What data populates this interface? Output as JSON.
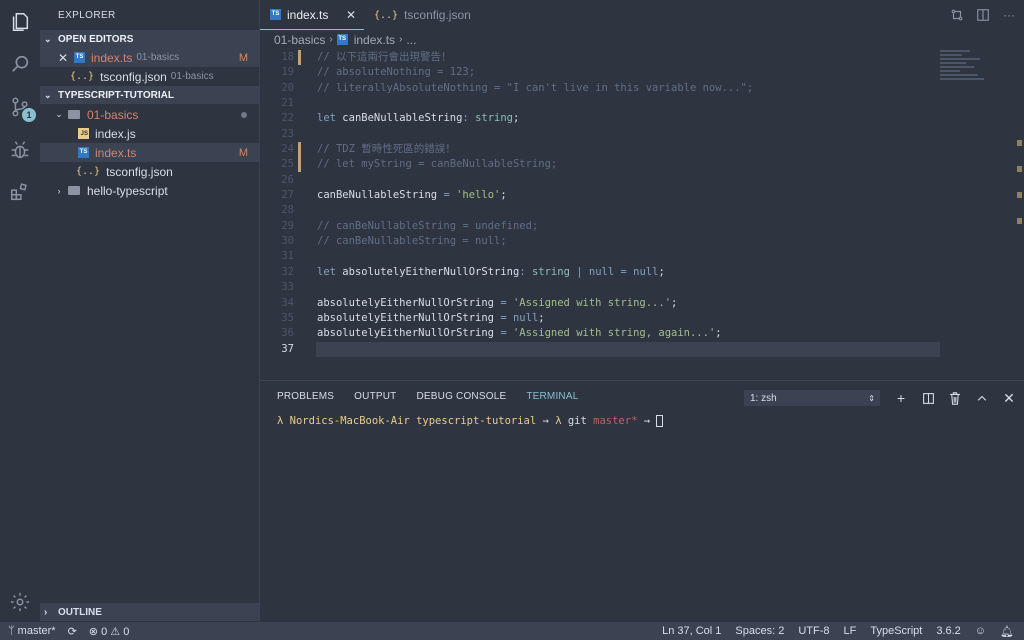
{
  "sidebar": {
    "title": "EXPLORER",
    "open_editors": {
      "header": "OPEN EDITORS",
      "items": [
        {
          "name": "index.ts",
          "desc": "01-basics",
          "badge": "M"
        },
        {
          "name": "tsconfig.json",
          "desc": "01-basics"
        }
      ]
    },
    "workspace": {
      "header": "TYPESCRIPT-TUTORIAL",
      "items": [
        {
          "name": "01-basics"
        },
        {
          "name": "index.js"
        },
        {
          "name": "index.ts",
          "badge": "M"
        },
        {
          "name": "tsconfig.json"
        },
        {
          "name": "hello-typescript"
        }
      ]
    },
    "outline_header": "OUTLINE"
  },
  "activity": {
    "scm_badge": "1"
  },
  "tabs": [
    {
      "label": "index.ts",
      "icon": "TS"
    },
    {
      "label": "tsconfig.json",
      "icon": "{..}"
    }
  ],
  "breadcrumb": {
    "folder": "01-basics",
    "file": "index.ts",
    "more": "..."
  },
  "code_lines": [
    {
      "n": "18",
      "mark": true,
      "tokens": [
        {
          "c": "cm",
          "t": "// 以下這兩行會出現警告！"
        }
      ]
    },
    {
      "n": "19",
      "mark": false,
      "tokens": [
        {
          "c": "cm",
          "t": "// absoluteNothing = 123;"
        }
      ]
    },
    {
      "n": "20",
      "mark": false,
      "tokens": [
        {
          "c": "cm",
          "t": "// literallyAbsoluteNothing = \"I can't live in this variable now...\";"
        }
      ]
    },
    {
      "n": "21",
      "mark": false,
      "tokens": []
    },
    {
      "n": "22",
      "mark": false,
      "tokens": [
        {
          "c": "kw",
          "t": "let "
        },
        {
          "c": "id",
          "t": "canBeNullableString"
        },
        {
          "c": "op",
          "t": ": "
        },
        {
          "c": "ty",
          "t": "string"
        },
        {
          "c": "id",
          "t": ";"
        }
      ]
    },
    {
      "n": "23",
      "mark": false,
      "tokens": []
    },
    {
      "n": "24",
      "mark": true,
      "tokens": [
        {
          "c": "cm",
          "t": "// TDZ 暫時性死區的錯誤！"
        }
      ]
    },
    {
      "n": "25",
      "mark": true,
      "tokens": [
        {
          "c": "cm",
          "t": "// let myString = canBeNullableString;"
        }
      ]
    },
    {
      "n": "26",
      "mark": false,
      "tokens": []
    },
    {
      "n": "27",
      "mark": false,
      "tokens": [
        {
          "c": "id",
          "t": "canBeNullableString "
        },
        {
          "c": "op",
          "t": "= "
        },
        {
          "c": "st",
          "t": "'hello'"
        },
        {
          "c": "id",
          "t": ";"
        }
      ]
    },
    {
      "n": "28",
      "mark": false,
      "tokens": []
    },
    {
      "n": "29",
      "mark": false,
      "tokens": [
        {
          "c": "cm",
          "t": "// canBeNullableString = undefined;"
        }
      ]
    },
    {
      "n": "30",
      "mark": false,
      "tokens": [
        {
          "c": "cm",
          "t": "// canBeNullableString = null;"
        }
      ]
    },
    {
      "n": "31",
      "mark": false,
      "tokens": []
    },
    {
      "n": "32",
      "mark": false,
      "tokens": [
        {
          "c": "kw",
          "t": "let "
        },
        {
          "c": "id",
          "t": "absolutelyEitherNullOrString"
        },
        {
          "c": "op",
          "t": ": "
        },
        {
          "c": "ty",
          "t": "string "
        },
        {
          "c": "op",
          "t": "| "
        },
        {
          "c": "kw",
          "t": "null "
        },
        {
          "c": "op",
          "t": "= "
        },
        {
          "c": "kw",
          "t": "null"
        },
        {
          "c": "id",
          "t": ";"
        }
      ]
    },
    {
      "n": "33",
      "mark": false,
      "tokens": []
    },
    {
      "n": "34",
      "mark": false,
      "tokens": [
        {
          "c": "id",
          "t": "absolutelyEitherNullOrString "
        },
        {
          "c": "op",
          "t": "= "
        },
        {
          "c": "st",
          "t": "'Assigned with string...'"
        },
        {
          "c": "id",
          "t": ";"
        }
      ]
    },
    {
      "n": "35",
      "mark": false,
      "tokens": [
        {
          "c": "id",
          "t": "absolutelyEitherNullOrString "
        },
        {
          "c": "op",
          "t": "= "
        },
        {
          "c": "kw",
          "t": "null"
        },
        {
          "c": "id",
          "t": ";"
        }
      ]
    },
    {
      "n": "36",
      "mark": false,
      "tokens": [
        {
          "c": "id",
          "t": "absolutelyEitherNullOrString "
        },
        {
          "c": "op",
          "t": "= "
        },
        {
          "c": "st",
          "t": "'Assigned with string, again...'"
        },
        {
          "c": "id",
          "t": ";"
        }
      ]
    },
    {
      "n": "37",
      "mark": false,
      "current": true,
      "tokens": []
    }
  ],
  "panel": {
    "tabs": [
      "PROBLEMS",
      "OUTPUT",
      "DEBUG CONSOLE",
      "TERMINAL"
    ],
    "active_tab": "TERMINAL",
    "terminal_select": "1: zsh",
    "prompt": {
      "lambda": "λ",
      "host": "Nordics-MacBook-Air",
      "dir": "typescript-tutorial",
      "arrow": "→",
      "git": "git",
      "branch": "master*"
    }
  },
  "status": {
    "branch": "master*",
    "errors": "0",
    "warnings": "0",
    "position": "Ln 37, Col 1",
    "indent": "Spaces: 2",
    "encoding": "UTF-8",
    "eol": "LF",
    "language": "TypeScript",
    "version": "3.6.2"
  },
  "colors": {
    "background": "#2e3440",
    "accent": "#88c0d0",
    "modified": "#d08770",
    "string": "#a3be8c",
    "keyword": "#81a1c1",
    "comment": "#616e88"
  }
}
